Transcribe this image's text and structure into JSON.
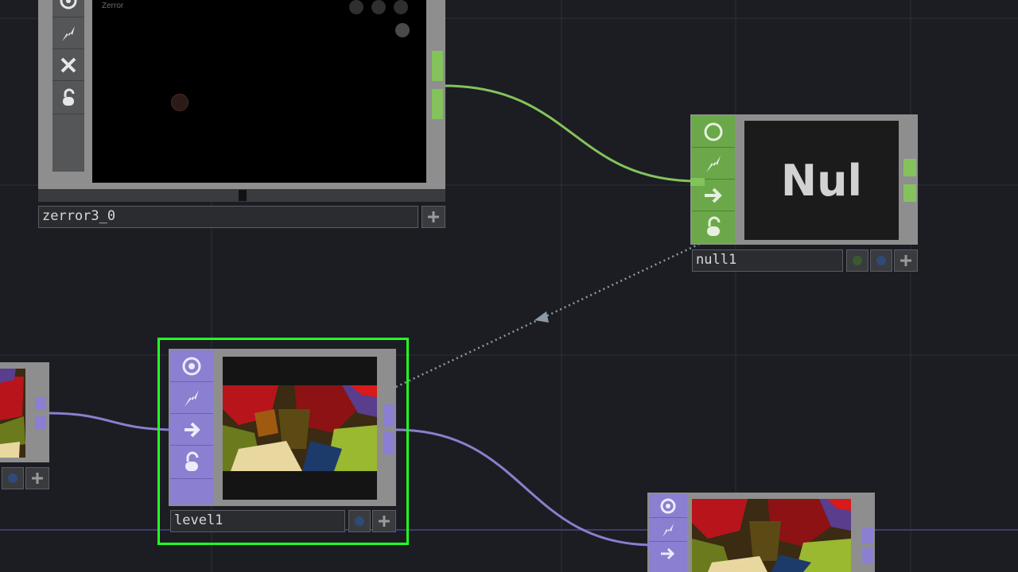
{
  "network": {
    "nodes": {
      "zerror": {
        "name": "zerror3_0",
        "viewer_label": "Zerror"
      },
      "null": {
        "name": "null1",
        "viewer_text": "Nul"
      },
      "level": {
        "name": "level1",
        "selected": true
      },
      "left_partial": {},
      "bottom_partial": {}
    },
    "colors": {
      "canvas": "#1c1d22",
      "chop_green": "#84c35c",
      "top_purple": "#8a7fd0",
      "selection_green": "#22ff22"
    },
    "icons": [
      "viewer-toggle-icon",
      "bypass-icon",
      "cook-icon",
      "lock-icon",
      "close-icon",
      "add-icon"
    ]
  }
}
